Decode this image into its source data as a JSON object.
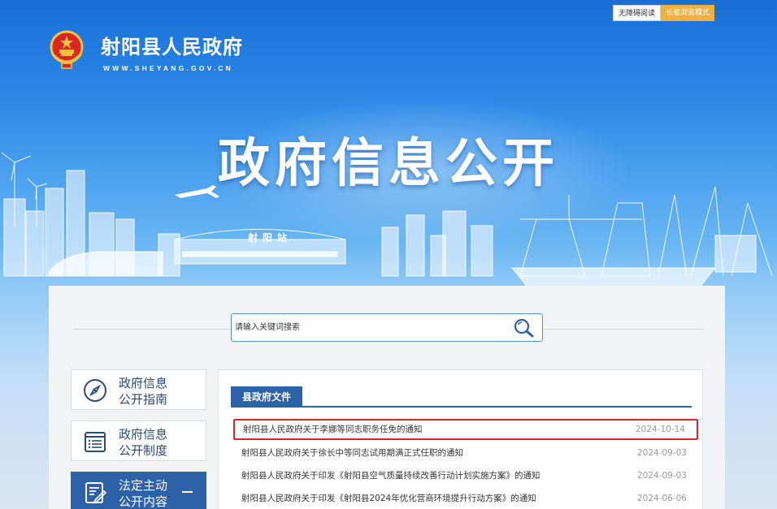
{
  "header": {
    "accessibility_link": "无障碍阅读",
    "elder_mode_link": "长者浏览模式",
    "site_title": "射阳县人民政府",
    "site_domain": "WWW.SHEYANG.GOV.CN",
    "hero_title": "政府信息公开",
    "station_label": "射阳站"
  },
  "search": {
    "placeholder": "请输入关键词搜索",
    "icon": "search-icon"
  },
  "sidebar": {
    "items": [
      {
        "line1": "政府信息",
        "line2": "公开指南",
        "icon": "compass-icon",
        "active": false
      },
      {
        "line1": "政府信息",
        "line2": "公开制度",
        "icon": "document-list-icon",
        "active": false
      },
      {
        "line1": "法定主动",
        "line2": "公开内容",
        "icon": "edit-document-icon",
        "active": true
      }
    ]
  },
  "section": {
    "tab_label": "县政府文件"
  },
  "articles": [
    {
      "title": "射阳县人民政府关于李娜等同志职务任免的通知",
      "date": "2024-10-14",
      "highlighted": true
    },
    {
      "title": "射阳县人民政府关于徐长中等同志试用期满正式任职的通知",
      "date": "2024-09-03",
      "highlighted": false
    },
    {
      "title": "射阳县人民政府关于印发《射阳县空气质量持续改善行动计划实施方案》的通知",
      "date": "2024-09-03",
      "highlighted": false
    },
    {
      "title": "射阳县人民政府关于印发《射阳县2024年优化营商环境提升行动方案》的通知",
      "date": "2024-06-06",
      "highlighted": false
    }
  ],
  "colors": {
    "primary_blue": "#2e62a8",
    "highlight_red": "#d9262b",
    "elder_mode_orange": "#f0b040"
  }
}
